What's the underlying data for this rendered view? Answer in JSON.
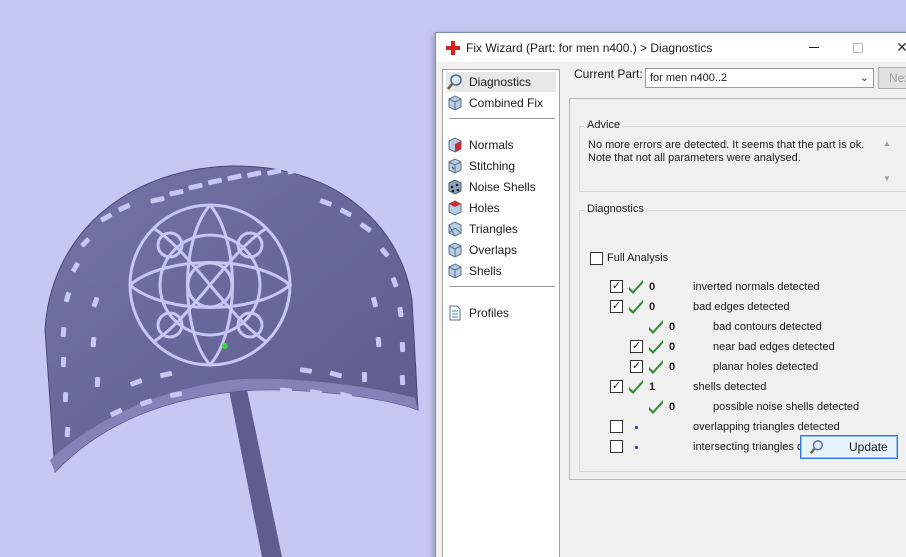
{
  "window": {
    "title": "Fix Wizard (Part: for men n400.) > Diagnostics",
    "minimize": "–",
    "maximize": "□",
    "close": "✕"
  },
  "nav": {
    "items": [
      {
        "label": "Diagnostics",
        "icon": "magnifier-icon",
        "selected": true
      },
      {
        "label": "Combined Fix",
        "icon": "cube-icon"
      },
      {
        "label": "Normals",
        "icon": "normals-cube-icon"
      },
      {
        "label": "Stitching",
        "icon": "stitching-cube-icon"
      },
      {
        "label": "Noise Shells",
        "icon": "noise-shells-cube-icon"
      },
      {
        "label": "Holes",
        "icon": "holes-cube-icon"
      },
      {
        "label": "Triangles",
        "icon": "triangles-cube-icon"
      },
      {
        "label": "Overlaps",
        "icon": "overlaps-cube-icon"
      },
      {
        "label": "Shells",
        "icon": "shells-cube-icon"
      },
      {
        "label": "Profiles",
        "icon": "document-icon"
      }
    ]
  },
  "current_part": {
    "label": "Current Part:",
    "value": "for men n400..2",
    "next_label": "Nex"
  },
  "advice": {
    "title": "Advice",
    "line1": "No more errors are detected. It seems that the part is ok.",
    "line2": "Note that not all parameters were analysed."
  },
  "diagnostics": {
    "title": "Diagnostics",
    "full_analysis_label": "Full Analysis",
    "full_analysis_checked": false,
    "rows": [
      {
        "checked": true,
        "status": "ok",
        "count": "0",
        "label": "inverted normals detected",
        "indent": 0
      },
      {
        "checked": true,
        "status": "ok",
        "count": "0",
        "label": "bad edges detected",
        "indent": 0
      },
      {
        "checked": null,
        "status": "ok",
        "count": "0",
        "label": "bad contours detected",
        "indent": 1
      },
      {
        "checked": true,
        "status": "ok",
        "count": "0",
        "label": "near bad edges detected",
        "indent": 1
      },
      {
        "checked": true,
        "status": "ok",
        "count": "0",
        "label": "planar holes detected",
        "indent": 1
      },
      {
        "checked": true,
        "status": "ok",
        "count": "1",
        "label": "shells detected",
        "indent": 0
      },
      {
        "checked": null,
        "status": "ok",
        "count": "0",
        "label": "possible noise shells detected",
        "indent": 1
      },
      {
        "checked": false,
        "status": "pending",
        "count": "",
        "label": "overlapping triangles detected",
        "indent": 0
      },
      {
        "checked": false,
        "status": "pending",
        "count": "",
        "label": "intersecting triangles detected",
        "indent": 0
      }
    ],
    "update_label": "Update"
  },
  "colors": {
    "viewport_background": "#c7c7f4",
    "model": "#6b6a9c",
    "check_green": "#2e8b2e"
  }
}
